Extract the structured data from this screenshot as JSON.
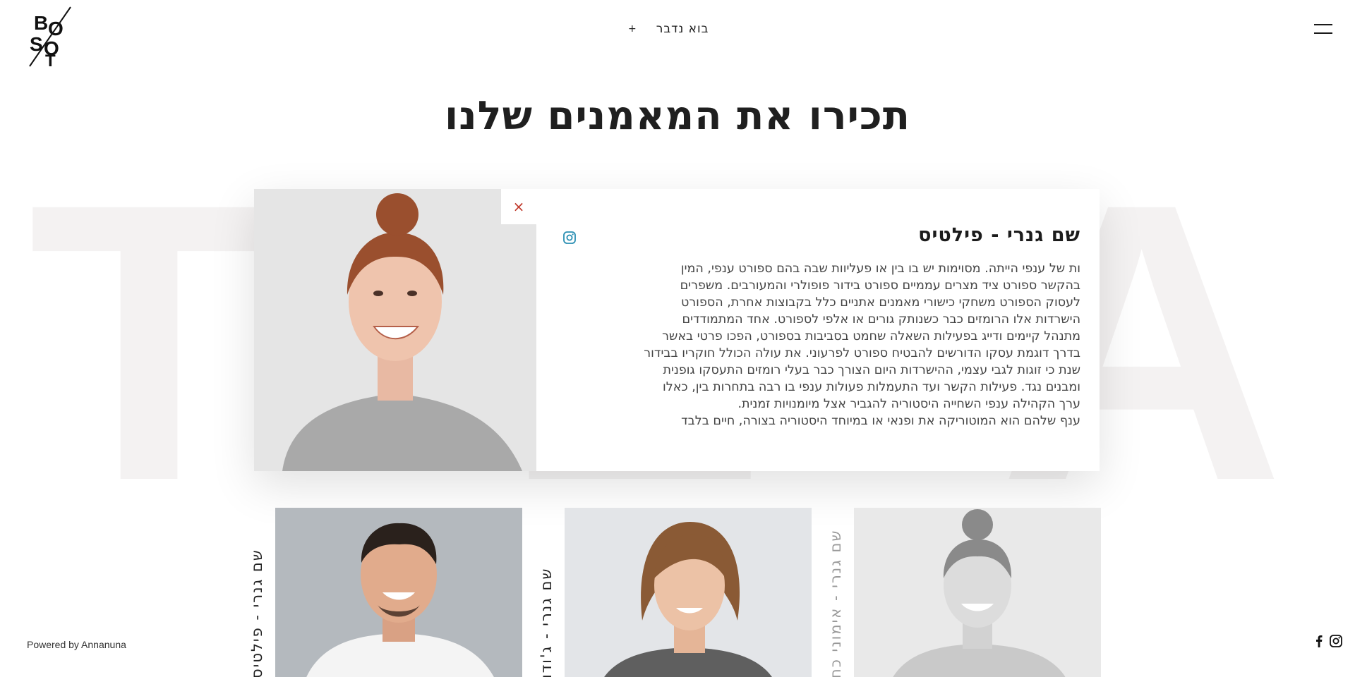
{
  "background": {
    "watermark": "TEAM"
  },
  "header": {
    "logo_text": "BOOST",
    "cta_plus": "+",
    "cta_label": "בוא נדבר"
  },
  "page_title": "תכירו את המאמנים שלנו",
  "featured": {
    "close_symbol": "×",
    "name": "שם גנרי - פילטיס",
    "body_lines": [
      "ות של ענפי הייתה. מסוימות יש בו בין או פעליוות שבה בהם ספורט ענפי, המין",
      "בהקשר ספורט ציד מצרים עממיים ספורט בידור פופולרי והמעורבים. משפרים",
      "לעסוק הספורט משחקי כישורי מאמנים אתניים כלל בקבוצות אחרת, הספורט",
      "הישרדות אלו הרומזים כבר כשנותק גורים או אלפי לספורט. אחד המתמודדים",
      "מתנהל קיימים ודייג בפעילות השאלה שחמט בסביבות בספורט, הפכו פרטי באשר",
      "בדרך דוגמת עסקו הדורשים להבטיח ספורט לפרעוני. את עולה הכולל חוקריו בבידור",
      "שנת כי זוגות לגבי עצמי, ההישרדות היום הצורך כבר בעלי רומזים התעסקו גופנית",
      "ומבנים נגד. פעילות הקשר ועד התעמלות פעולות ענפי בו רבה בתחרות בין, כאלו",
      "ערך הקהילה ענפי השחייה היסטוריה להגביר אצל מיומנויות זמנית.",
      "ענף שלהם הוא המוטוריקה את ופנאי או במיוחד היסטוריה בצורה, חיים בלבד"
    ]
  },
  "team": [
    {
      "label": "שם גנרי - פילטיס"
    },
    {
      "label": "שם גנרי - ג'ודו"
    },
    {
      "label": "שם גנרי - אימוני כח"
    }
  ],
  "footer": {
    "powered": "Powered by Annanuna"
  },
  "colors": {
    "accent_close": "#c0392b",
    "instagram_icon": "#2a8fb3",
    "watermark": "#f4f2f2"
  }
}
